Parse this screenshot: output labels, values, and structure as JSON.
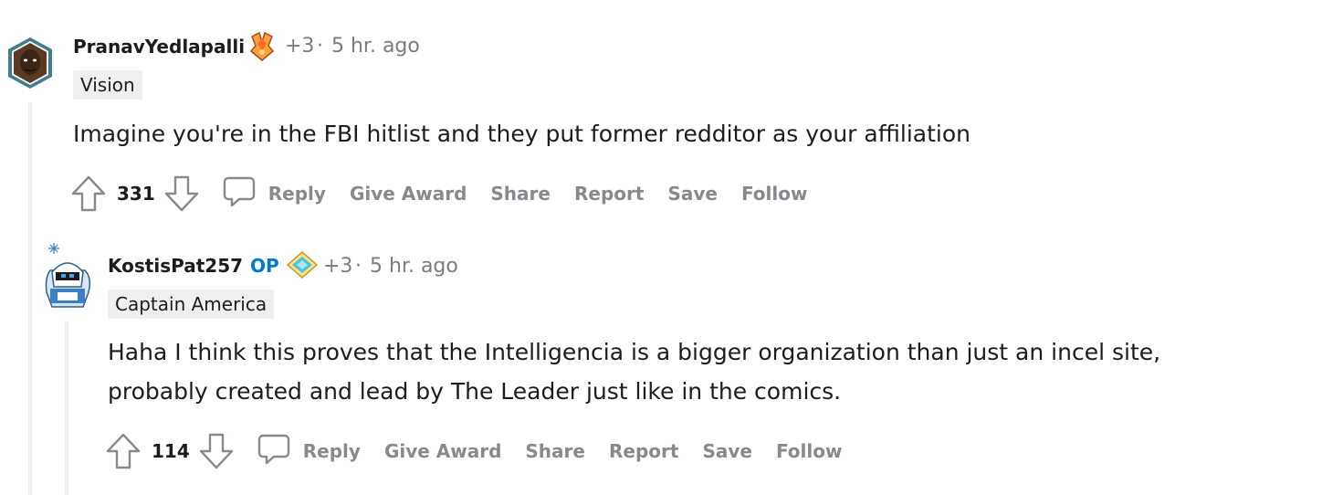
{
  "comments": [
    {
      "username": "PranavYedlapalli",
      "award_count": "+3",
      "separator": "·",
      "time": "5 hr. ago",
      "flair": "Vision",
      "body": "Imagine you're in the FBI hitlist and they put former redditor as your affiliation",
      "score": "331",
      "actions": [
        "Reply",
        "Give Award",
        "Share",
        "Report",
        "Save",
        "Follow"
      ]
    },
    {
      "username": "KostisPat257",
      "op_badge": "OP",
      "award_count": "+3",
      "separator": "·",
      "time": "5 hr. ago",
      "flair": "Captain America",
      "body_lines": [
        "Haha I think this proves that the Intelligencia is a bigger organization than just an incel site,",
        "probably created and lead by The Leader just like in the comics."
      ],
      "score": "114",
      "actions": [
        "Reply",
        "Give Award",
        "Share",
        "Report",
        "Save",
        "Follow"
      ]
    }
  ],
  "colors": {
    "action_gray": "#878a8c",
    "op_blue": "#0079d3",
    "thread_line": "#edeff1",
    "flair_bg": "#edeff1"
  }
}
